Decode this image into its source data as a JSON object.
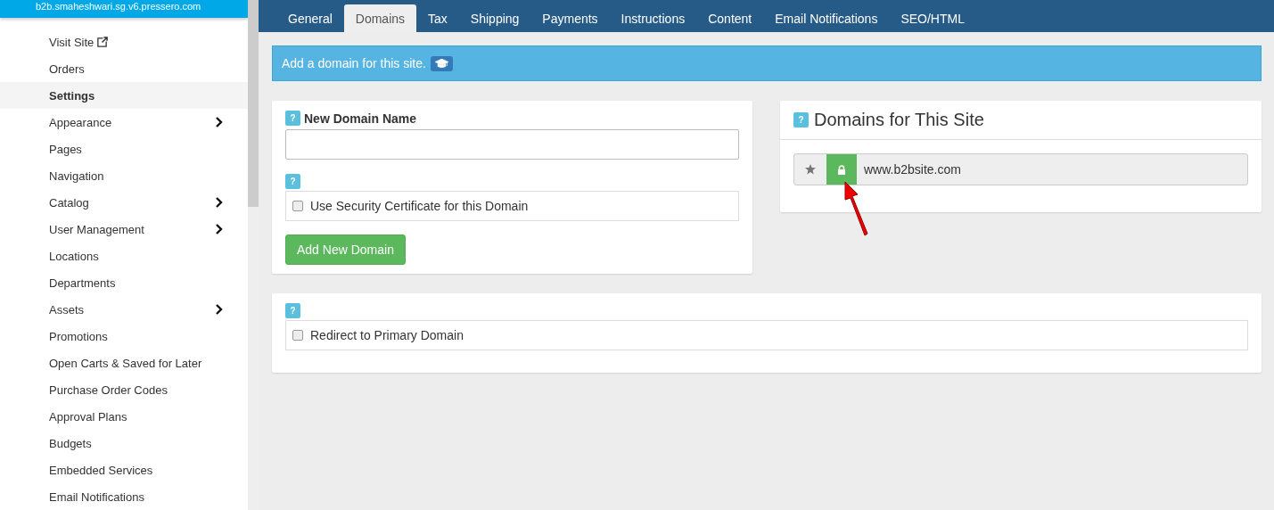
{
  "sidebar": {
    "site": "b2b.smaheshwari.sg.v6.pressero.com",
    "items": [
      {
        "label": "Visit Site",
        "external": true,
        "expandable": false,
        "selected": false
      },
      {
        "label": "Orders",
        "external": false,
        "expandable": false,
        "selected": false
      },
      {
        "label": "Settings",
        "external": false,
        "expandable": false,
        "selected": true
      },
      {
        "label": "Appearance",
        "external": false,
        "expandable": true,
        "selected": false
      },
      {
        "label": "Pages",
        "external": false,
        "expandable": false,
        "selected": false
      },
      {
        "label": "Navigation",
        "external": false,
        "expandable": false,
        "selected": false
      },
      {
        "label": "Catalog",
        "external": false,
        "expandable": true,
        "selected": false
      },
      {
        "label": "User Management",
        "external": false,
        "expandable": true,
        "selected": false
      },
      {
        "label": "Locations",
        "external": false,
        "expandable": false,
        "selected": false
      },
      {
        "label": "Departments",
        "external": false,
        "expandable": false,
        "selected": false
      },
      {
        "label": "Assets",
        "external": false,
        "expandable": true,
        "selected": false
      },
      {
        "label": "Promotions",
        "external": false,
        "expandable": false,
        "selected": false
      },
      {
        "label": "Open Carts & Saved for Later",
        "external": false,
        "expandable": false,
        "selected": false
      },
      {
        "label": "Purchase Order Codes",
        "external": false,
        "expandable": false,
        "selected": false
      },
      {
        "label": "Approval Plans",
        "external": false,
        "expandable": false,
        "selected": false
      },
      {
        "label": "Budgets",
        "external": false,
        "expandable": false,
        "selected": false
      },
      {
        "label": "Embedded Services",
        "external": false,
        "expandable": false,
        "selected": false
      },
      {
        "label": "Email Notifications",
        "external": false,
        "expandable": false,
        "selected": false
      }
    ]
  },
  "tabs": [
    {
      "label": "General",
      "selected": false
    },
    {
      "label": "Domains",
      "selected": true
    },
    {
      "label": "Tax",
      "selected": false
    },
    {
      "label": "Shipping",
      "selected": false
    },
    {
      "label": "Payments",
      "selected": false
    },
    {
      "label": "Instructions",
      "selected": false
    },
    {
      "label": "Content",
      "selected": false
    },
    {
      "label": "Email Notifications",
      "selected": false
    },
    {
      "label": "SEO/HTML",
      "selected": false
    }
  ],
  "alert": {
    "text": "Add a domain for this site."
  },
  "new_domain": {
    "label": "New Domain Name",
    "help": "?",
    "certificate_help": "?",
    "certificate": {
      "label": "Use Security Certificate for this Domain",
      "checked": false
    },
    "button": "Add New Domain"
  },
  "domains_panel": {
    "help": "?",
    "title": "Domains for This Site",
    "domains": [
      {
        "name": "www.b2bsite.com",
        "secure": true
      }
    ]
  },
  "redirect": {
    "help": "?",
    "label": "Redirect to Primary Domain",
    "checked": false
  }
}
